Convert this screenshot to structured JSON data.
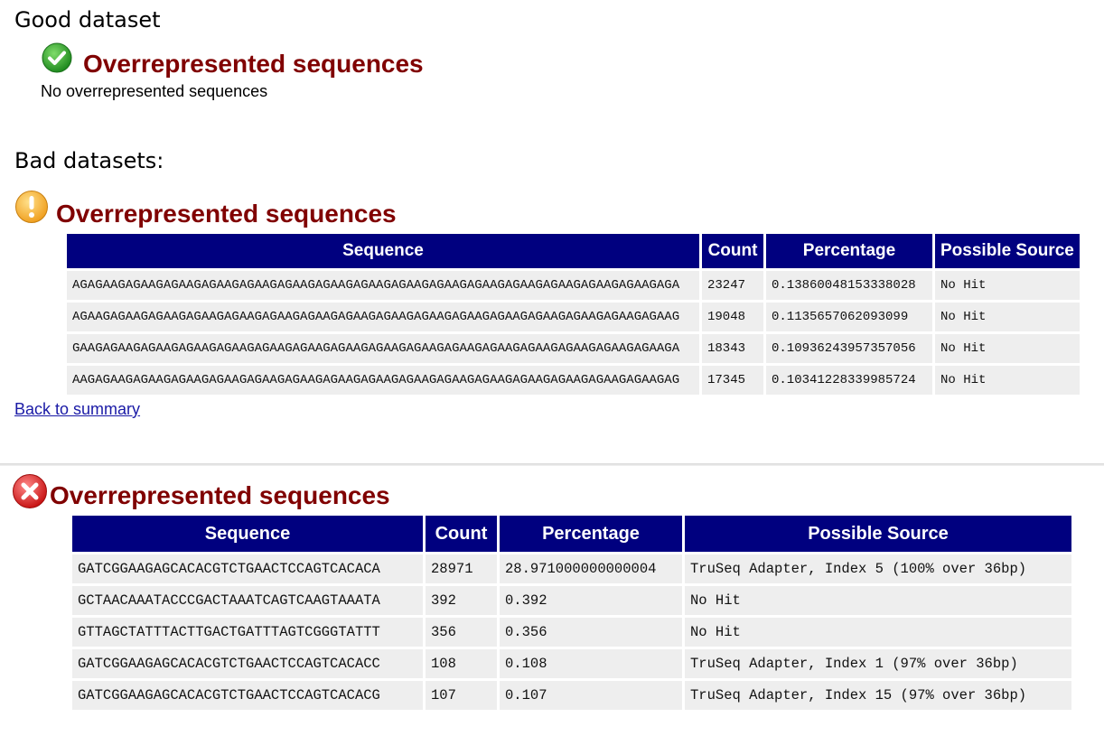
{
  "labels": {
    "good": "Good dataset",
    "bad": "Bad datasets:"
  },
  "good_panel": {
    "status_icon": "check-circle-icon",
    "status_color": "#2e9e2e",
    "title": "Overrepresented sequences",
    "message": "No overrepresented sequences"
  },
  "warn_panel": {
    "status_icon": "warning-circle-icon",
    "status_color": "#f0a020",
    "title": "Overrepresented sequences",
    "columns": [
      "Sequence",
      "Count",
      "Percentage",
      "Possible Source"
    ],
    "rows": [
      [
        "AGAGAAGAGAAGAGAAGAGAAGAGAAGAGAAGAGAAGAGAAGAGAAGAGAAGAGAAGAGAAGAGAAGAGAAGAGAAGAGA",
        "23247",
        "0.13860048153338028",
        "No Hit"
      ],
      [
        "AGAAGAGAAGAGAAGAGAAGAGAAGAGAAGAGAAGAGAAGAGAAGAGAAGAGAAGAGAAGAGAAGAGAAGAGAAGAGAAG",
        "19048",
        "0.1135657062093099",
        "No Hit"
      ],
      [
        "GAAGAGAAGAGAAGAGAAGAGAAGAGAAGAGAAGAGAAGAGAAGAGAAGAGAAGAGAAGAGAAGAGAAGAGAAGAGAAGA",
        "18343",
        "0.10936243957357056",
        "No Hit"
      ],
      [
        "AAGAGAAGAGAAGAGAAGAGAAGAGAAGAGAAGAGAAGAGAAGAGAAGAGAAGAGAAGAGAAGAGAAGAGAAGAGAAGAG",
        "17345",
        "0.10341228339985724",
        "No Hit"
      ]
    ],
    "back_link": "Back to summary"
  },
  "fail_panel": {
    "status_icon": "error-circle-icon",
    "status_color": "#d62020",
    "title": "Overrepresented sequences",
    "columns": [
      "Sequence",
      "Count",
      "Percentage",
      "Possible Source"
    ],
    "rows": [
      [
        "GATCGGAAGAGCACACGTCTGAACTCCAGTCACACA",
        "28971",
        "28.971000000000004",
        "TruSeq Adapter, Index 5 (100% over 36bp)"
      ],
      [
        "GCTAACAAATACCCGACTAAATCAGTCAAGTAAATA",
        "392",
        "0.392",
        "No Hit"
      ],
      [
        "GTTAGCTATTTACTTGACTGATTTAGTCGGGTATTT",
        "356",
        "0.356",
        "No Hit"
      ],
      [
        "GATCGGAAGAGCACACGTCTGAACTCCAGTCACACC",
        "108",
        "0.108",
        "TruSeq Adapter, Index 1 (97% over 36bp)"
      ],
      [
        "GATCGGAAGAGCACACGTCTGAACTCCAGTCACACG",
        "107",
        "0.107",
        "TruSeq Adapter, Index 15 (97% over 36bp)"
      ]
    ]
  }
}
